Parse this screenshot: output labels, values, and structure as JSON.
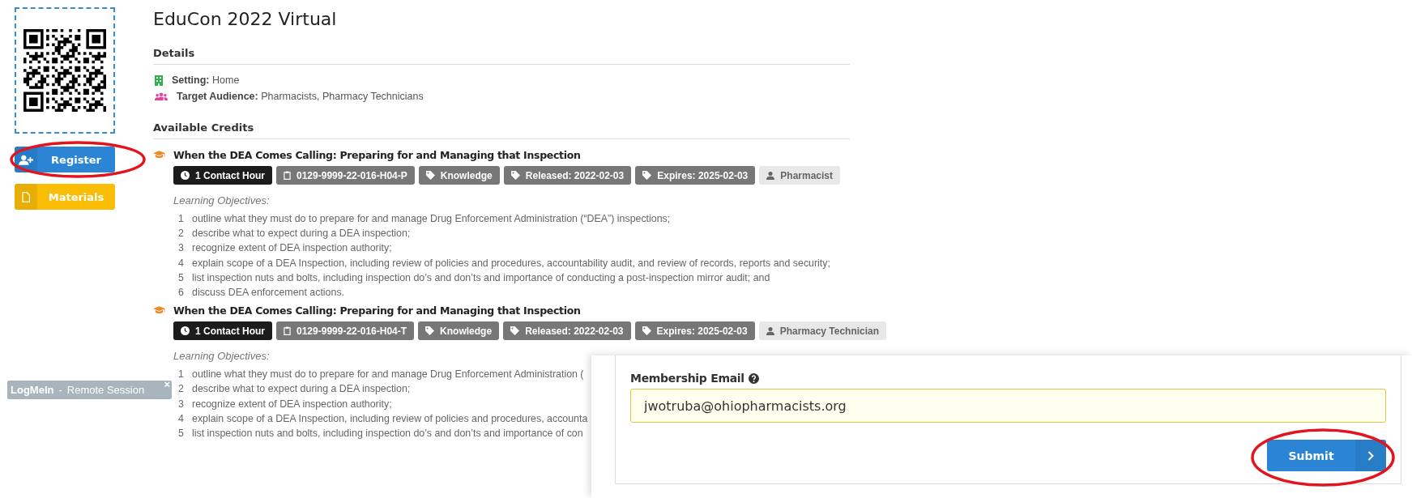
{
  "sidebar": {
    "buttons": [
      {
        "label": "Register",
        "kind": "register"
      },
      {
        "label": "Materials",
        "kind": "materials"
      }
    ]
  },
  "title": "EduCon 2022 Virtual",
  "details": {
    "heading": "Details",
    "rows": [
      {
        "kind": "setting",
        "label": "Setting:",
        "value": "Home"
      },
      {
        "kind": "audience",
        "label": "Target Audience:",
        "value": "Pharmacists, Pharmacy Technicians"
      }
    ]
  },
  "credits": {
    "heading": "Available Credits",
    "items": [
      {
        "title": "When the DEA Comes Calling: Preparing for and Managing that Inspection",
        "badges": [
          {
            "kind": "hours",
            "text": "1 Contact Hour"
          },
          {
            "kind": "code",
            "text": "0129-9999-22-016-H04-P"
          },
          {
            "kind": "tag",
            "text": "Knowledge"
          },
          {
            "kind": "tag",
            "text": "Released: 2022-02-03"
          },
          {
            "kind": "tag",
            "text": "Expires: 2025-02-03"
          },
          {
            "kind": "role",
            "text": "Pharmacist"
          }
        ],
        "objectives_label": "Learning Objectives:",
        "objectives": [
          {
            "number": "1",
            "text": "outline what they must do to prepare for and manage Drug Enforcement Administration (“DEA”) inspections;"
          },
          {
            "number": "2",
            "text": "describe what to expect during a DEA inspection;"
          },
          {
            "number": "3",
            "text": "recognize extent of DEA inspection authority;"
          },
          {
            "number": "4",
            "text": "explain scope of a DEA Inspection, including review of policies and procedures, accountability audit, and review of records, reports and security;"
          },
          {
            "number": "5",
            "text": "list inspection nuts and bolts, including inspection do’s and don’ts and importance of conducting a post-inspection mirror audit; and"
          },
          {
            "number": "6",
            "text": "discuss DEA enforcement actions."
          }
        ]
      },
      {
        "title": "When the DEA Comes Calling: Preparing for and Managing that Inspection",
        "badges": [
          {
            "kind": "hours",
            "text": "1 Contact Hour"
          },
          {
            "kind": "code",
            "text": "0129-9999-22-016-H04-T"
          },
          {
            "kind": "tag",
            "text": "Knowledge"
          },
          {
            "kind": "tag",
            "text": "Released: 2022-02-03"
          },
          {
            "kind": "tag",
            "text": "Expires: 2025-02-03"
          },
          {
            "kind": "role",
            "text": "Pharmacy Technician"
          }
        ],
        "objectives_label": "Learning Objectives:",
        "objectives": [
          {
            "number": "1",
            "text": "outline what they must do to prepare for and manage Drug Enforcement Administration ("
          },
          {
            "number": "2",
            "text": "describe what to expect during a DEA inspection;"
          },
          {
            "number": "3",
            "text": "recognize extent of DEA inspection authority;"
          },
          {
            "number": "4",
            "text": "explain scope of a DEA Inspection, including review of policies and procedures, accounta"
          },
          {
            "number": "5",
            "text": "list inspection nuts and bolts, including inspection do’s and don’ts and importance of con"
          }
        ]
      }
    ]
  },
  "remote_session": {
    "brand": "LogMeIn",
    "separator": "-",
    "label": "Remote Session",
    "close": "×"
  },
  "form": {
    "label": "Membership Email",
    "value": "jwotruba@ohiopharmacists.org",
    "submit": "Submit"
  }
}
